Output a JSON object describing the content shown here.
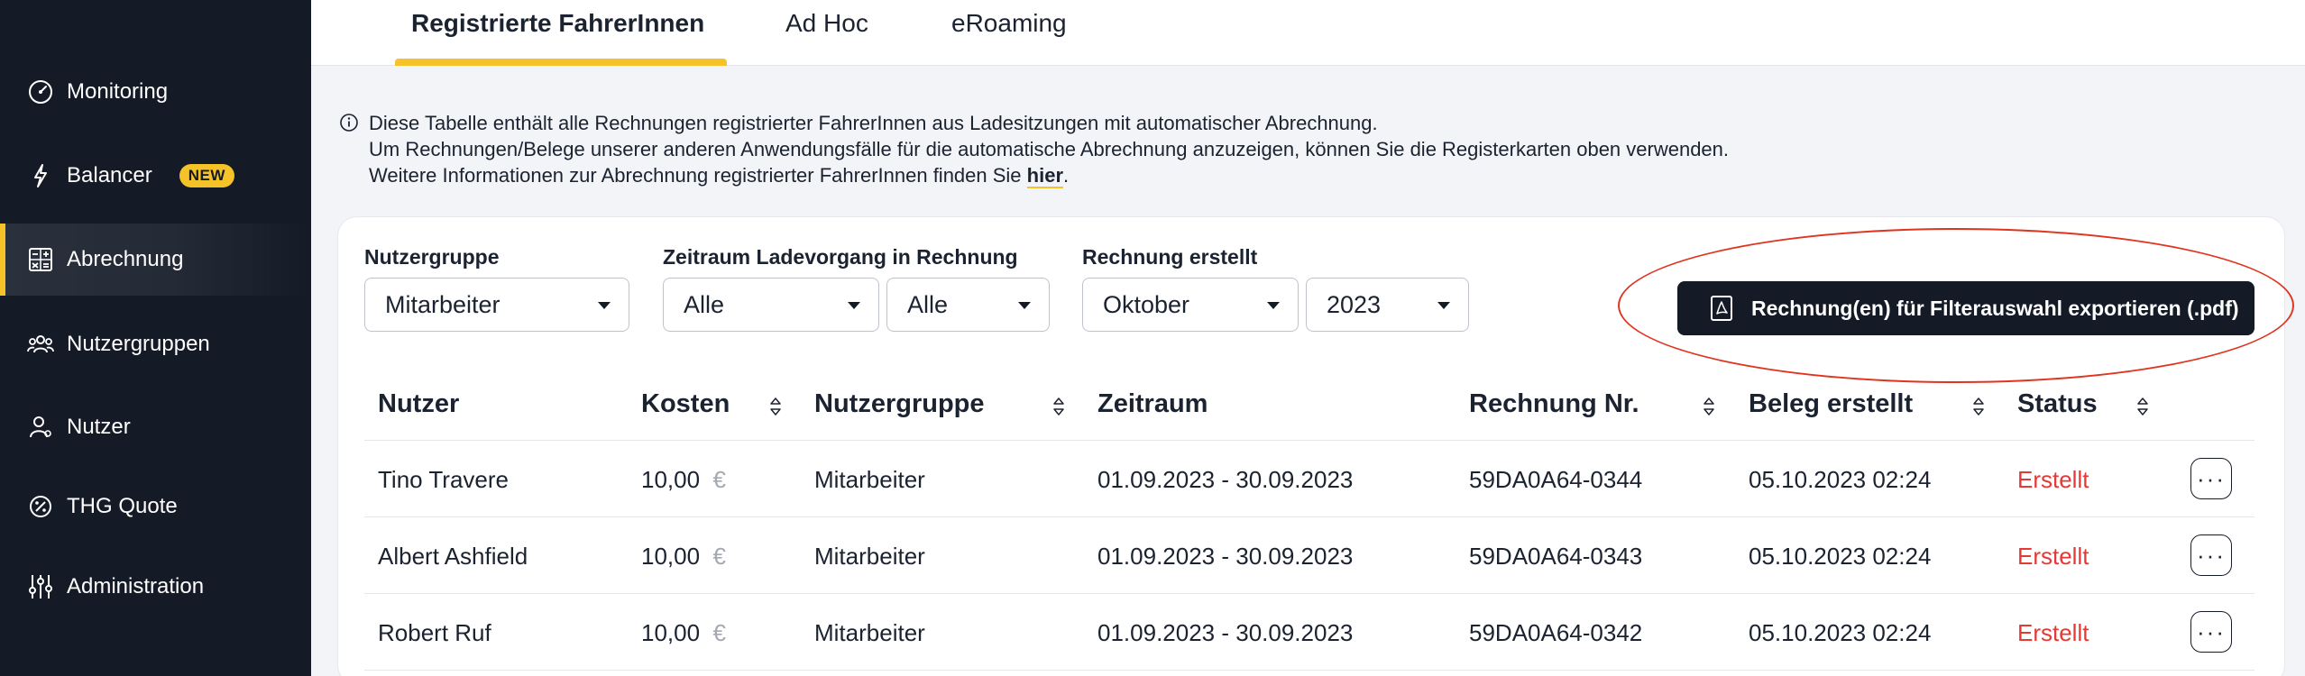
{
  "sidebar": {
    "items": [
      {
        "label": "Monitoring",
        "icon": "gauge-icon"
      },
      {
        "label": "Balancer",
        "icon": "lightning-icon",
        "badge": "NEW"
      },
      {
        "label": "Abrechnung",
        "icon": "invoice-calculator-icon",
        "active": true
      },
      {
        "label": "Nutzergruppen",
        "icon": "users-group-icon"
      },
      {
        "label": "Nutzer",
        "icon": "user-icon"
      },
      {
        "label": "THG Quote",
        "icon": "percent-badge-icon"
      },
      {
        "label": "Administration",
        "icon": "sliders-icon"
      }
    ]
  },
  "tabs": [
    {
      "label": "Registrierte FahrerInnen",
      "active": true
    },
    {
      "label": "Ad Hoc"
    },
    {
      "label": "eRoaming"
    }
  ],
  "info": {
    "line1": "Diese Tabelle enthält alle Rechnungen registrierter FahrerInnen aus Ladesitzungen mit automatischer Abrechnung.",
    "line2": "Um Rechnungen/Belege unserer anderen Anwendungsfälle für die automatische Abrechnung anzuzeigen, können Sie die Registerkarten oben verwenden.",
    "line3_prefix": "Weitere Informationen zur Abrechnung registrierter FahrerInnen finden Sie ",
    "link": "hier",
    "line3_suffix": "."
  },
  "filters": {
    "nutzergruppe": {
      "label": "Nutzergruppe",
      "value": "Mitarbeiter"
    },
    "zeitraum": {
      "label": "Zeitraum Ladevorgang in Rechnung",
      "value_from": "Alle",
      "value_to": "Alle"
    },
    "rechnung": {
      "label": "Rechnung erstellt",
      "month": "Oktober",
      "year": "2023"
    }
  },
  "export_button": {
    "label": "Rechnung(en) für Filterauswahl exportieren (.pdf)"
  },
  "table": {
    "headers": [
      "Nutzer",
      "Kosten",
      "Nutzergruppe",
      "Zeitraum",
      "Rechnung Nr.",
      "Beleg erstellt",
      "Status"
    ],
    "currency": "€",
    "rows": [
      {
        "nutzer": "Tino Travere",
        "kosten": "10,00",
        "nutzergruppe": "Mitarbeiter",
        "zeitraum": "01.09.2023 - 30.09.2023",
        "rechnung_nr": "59DA0A64-0344",
        "beleg": "05.10.2023 02:24",
        "status": "Erstellt"
      },
      {
        "nutzer": "Albert Ashfield",
        "kosten": "10,00",
        "nutzergruppe": "Mitarbeiter",
        "zeitraum": "01.09.2023 - 30.09.2023",
        "rechnung_nr": "59DA0A64-0343",
        "beleg": "05.10.2023 02:24",
        "status": "Erstellt"
      },
      {
        "nutzer": "Robert Ruf",
        "kosten": "10,00",
        "nutzergruppe": "Mitarbeiter",
        "zeitraum": "01.09.2023 - 30.09.2023",
        "rechnung_nr": "59DA0A64-0342",
        "beleg": "05.10.2023 02:24",
        "status": "Erstellt"
      }
    ],
    "row_action": "···"
  },
  "colors": {
    "sidebar_bg": "#141a26",
    "accent": "#f5c228",
    "status_red": "#e53935",
    "highlight_ellipse": "#e0341f"
  }
}
